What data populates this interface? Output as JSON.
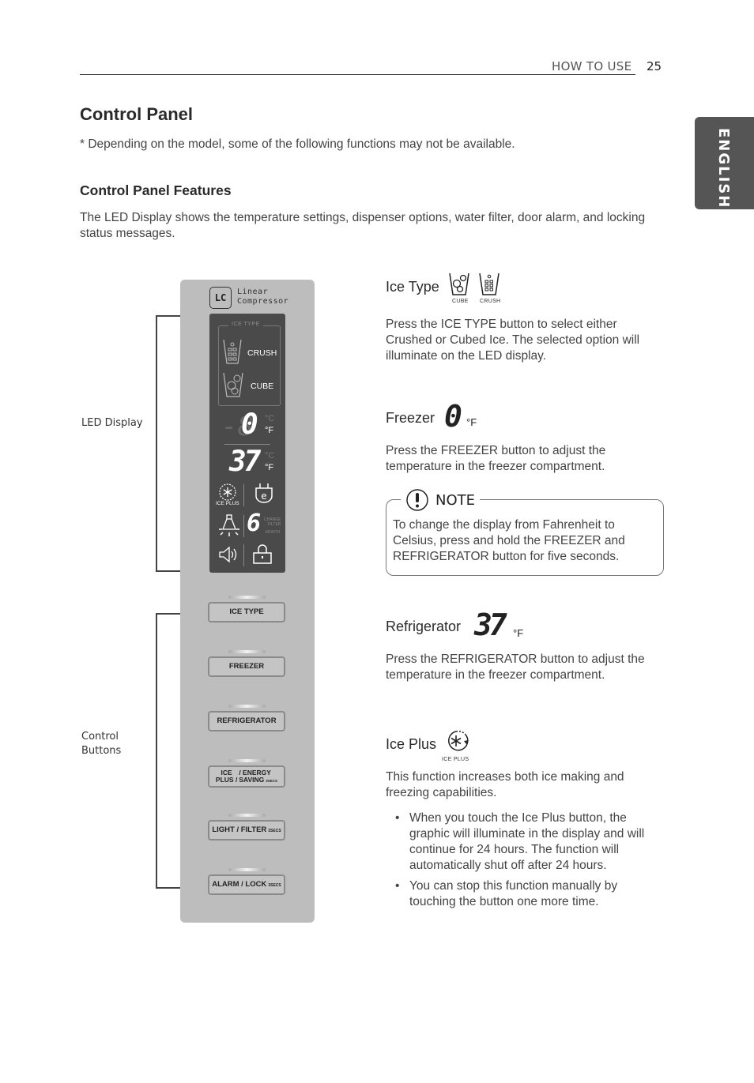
{
  "header": {
    "section": "HOW TO USE",
    "page_number": "25",
    "language_tab": "ENGLISH"
  },
  "title": "Control Panel",
  "availability_note": "* Depending on the model, some of the following functions may not be available.",
  "features_heading": "Control Panel Features",
  "features_intro": "The LED Display shows the temperature settings, dispenser options, water filter, door alarm, and locking status messages.",
  "diagram": {
    "callouts": {
      "led_display": "LED Display",
      "control_buttons_line1": "Control",
      "control_buttons_line2": "Buttons"
    },
    "logo": {
      "badge": "LC",
      "line1": "Linear",
      "line2": "Compressor"
    },
    "led": {
      "ice_type_title": "ICE TYPE",
      "crush_label": "CRUSH",
      "cube_label": "CUBE",
      "freezer_temp": "0",
      "freezer_unit_c": "°C",
      "freezer_unit_f": "°F",
      "fridge_temp": "37",
      "fridge_unit_c": "°C",
      "fridge_unit_f": "°F",
      "ice_plus_label": "ICE PLUS",
      "filter_months": "6",
      "change_filter_line1": "CHANGE",
      "change_filter_line2": "FILTER",
      "month_label": "MONTH"
    },
    "buttons": [
      {
        "label": "ICE TYPE"
      },
      {
        "label": "FREEZER"
      },
      {
        "label": "REFRIGERATOR"
      },
      {
        "label_line1_left": "ICE",
        "label_line2_left": "PLUS /",
        "label_line1_right": "/ ENERGY",
        "label_line2_right": "SAVING",
        "hold_note": "3SECS"
      },
      {
        "label": "LIGHT / FILTER",
        "hold_note": "3SECS"
      },
      {
        "label": "ALARM / LOCK",
        "hold_note": "3SECS"
      }
    ]
  },
  "features": {
    "ice_type": {
      "title": "Ice Type",
      "icon_cube_caption": "CUBE",
      "icon_crush_caption": "CRUSH",
      "text": "Press the ICE TYPE button to select either Crushed or Cubed Ice. The selected option will illuminate on the LED display."
    },
    "freezer": {
      "title": "Freezer",
      "display_value": "0",
      "unit": "°F",
      "text": "Press the FREEZER button to adjust the temperature in the freezer compartment."
    },
    "note": {
      "heading": "NOTE",
      "text": "To change the display from Fahrenheit to Celsius, press and hold the FREEZER and REFRIGERATOR button for five seconds."
    },
    "refrigerator": {
      "title": "Refrigerator",
      "display_value": "37",
      "unit": "°F",
      "text": "Press the REFRIGERATOR button to adjust the temperature in the freezer compartment."
    },
    "ice_plus": {
      "title": "Ice Plus",
      "icon_caption": "ICE PLUS",
      "text": "This function increases both ice making and freezing capabilities.",
      "bullets": [
        "When you touch the Ice Plus button, the graphic will illuminate in the display and will continue for 24 hours. The function will automatically shut off after 24 hours.",
        "You can stop this function manually by touching the button one more time."
      ]
    }
  }
}
